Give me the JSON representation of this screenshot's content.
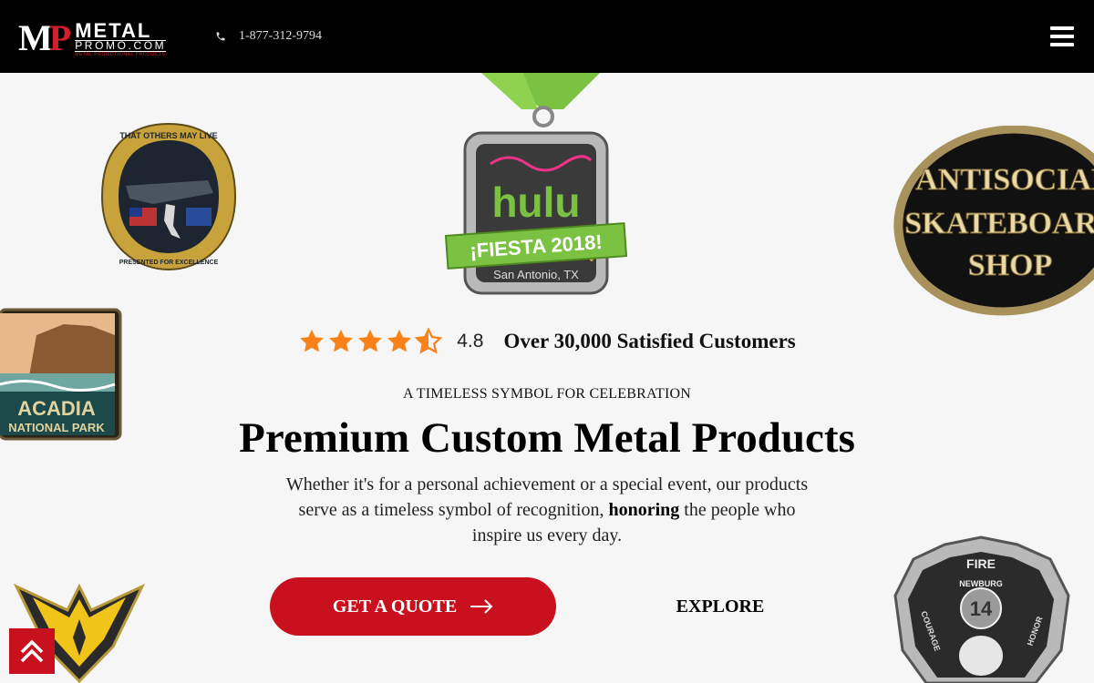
{
  "header": {
    "logo": {
      "letters_m": "M",
      "letters_p": "P",
      "word_top": "METAL",
      "word_bottom": "PROMO.COM",
      "tagline": "METAL PROMOTIONAL PRODUCTS"
    },
    "phone": "1-877-312-9794",
    "menu_icon": "hamburger-menu-icon"
  },
  "products": {
    "coin_text": [
      "THAT OTHERS MAY LIVE",
      "PRESENTED FOR EXCELLENCE"
    ],
    "medal_text": [
      "hulu",
      "¡FIESTA 2018!",
      "San Antonio, TX"
    ],
    "pin_text": [
      "ANTISOCIAL",
      "SKATEBOARD",
      "SHOP"
    ],
    "park_text": [
      "ACADIA",
      "NATIONAL PARK"
    ],
    "fire_text": [
      "FIRE",
      "NEWBURG",
      "14",
      "COURAGE",
      "HONOR"
    ]
  },
  "rating": {
    "value": "4.8",
    "stars_filled": 4.5,
    "stars_total": 5,
    "text": "Over 30,000 Satisfied Customers",
    "star_color": "#f7821b"
  },
  "hero": {
    "eyebrow": "A TIMELESS SYMBOL FOR CELEBRATION",
    "title": "Premium Custom Metal Products",
    "desc_part1": "Whether it's for a personal achievement or a special event, our products serve as a timeless symbol of recognition, ",
    "desc_bold": "honoring",
    "desc_part2": " the people who inspire us every day."
  },
  "buttons": {
    "quote": "GET A QUOTE",
    "explore": "EXPLORE"
  },
  "colors": {
    "accent": "#c8101e",
    "header_bg": "#000000"
  }
}
